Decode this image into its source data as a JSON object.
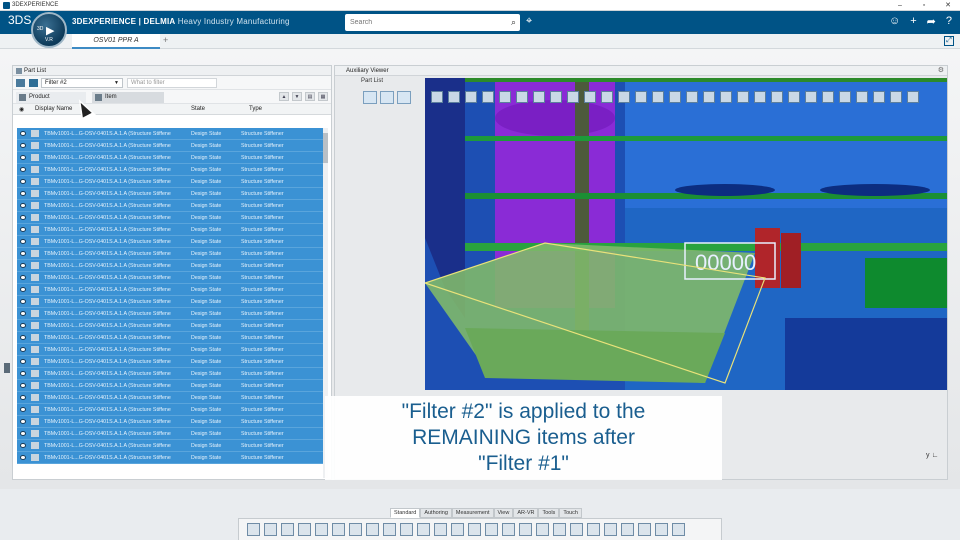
{
  "window": {
    "title": "3DEXPERIENCE",
    "controls": [
      "–",
      "▫",
      "✕"
    ]
  },
  "header": {
    "brand_mark": "3DS",
    "app_title_bold": "3DEXPERIENCE | DELMIA",
    "app_title_light": "Heavy Industry Manufacturing",
    "search_placeholder": "Search",
    "compass_label": "V.R",
    "compass_num": "3D"
  },
  "tabs": [
    {
      "label": "OSV01 PPR A"
    }
  ],
  "part_list": {
    "header": "Part List",
    "filter_value": "Filter #2",
    "filter_hint": "What to filter",
    "tabs": [
      {
        "label": "Product"
      },
      {
        "label": "Item"
      }
    ],
    "columns": {
      "name": "Display Name",
      "state": "State",
      "type": "Type"
    },
    "rows": [
      {
        "name": "TBMv1001-L...G-OSV-0401S.A.1.A (Structure Stiffene",
        "state": "Design State",
        "type": "Structure Stiffener"
      },
      {
        "name": "TBMv1001-L...G-OSV-0401S.A.1.A (Structure Stiffene",
        "state": "Design State",
        "type": "Structure Stiffener"
      },
      {
        "name": "TBMv1001-L...G-OSV-0401S.A.1.A (Structure Stiffene",
        "state": "Design State",
        "type": "Structure Stiffener"
      },
      {
        "name": "TBMv1001-L...G-OSV-0401S.A.1.A (Structure Stiffene",
        "state": "Design State",
        "type": "Structure Stiffener"
      },
      {
        "name": "TBMv1001-L...G-OSV-0401S.A.1.A (Structure Stiffene",
        "state": "Design State",
        "type": "Structure Stiffener"
      },
      {
        "name": "TBMv1001-L...G-OSV-0401S.A.1.A (Structure Stiffene",
        "state": "Design State",
        "type": "Structure Stiffener"
      },
      {
        "name": "TBMv1001-L...G-OSV-0401S.A.1.A (Structure Stiffene",
        "state": "Design State",
        "type": "Structure Stiffener"
      },
      {
        "name": "TBMv1001-L...G-OSV-0401S.A.1.A (Structure Stiffene",
        "state": "Design State",
        "type": "Structure Stiffener"
      },
      {
        "name": "TBMv1001-L...G-OSV-0401S.A.1.A (Structure Stiffene",
        "state": "Design State",
        "type": "Structure Stiffener"
      },
      {
        "name": "TBMv1001-L...G-OSV-0401S.A.1.A (Structure Stiffene",
        "state": "Design State",
        "type": "Structure Stiffener"
      },
      {
        "name": "TBMv1001-L...G-OSV-0401S.A.1.A (Structure Stiffene",
        "state": "Design State",
        "type": "Structure Stiffener"
      },
      {
        "name": "TBMv1001-L...G-OSV-0401S.A.1.A (Structure Stiffene",
        "state": "Design State",
        "type": "Structure Stiffener"
      },
      {
        "name": "TBMv1001-L...G-OSV-0401S.A.1.A (Structure Stiffene",
        "state": "Design State",
        "type": "Structure Stiffener"
      },
      {
        "name": "TBMv1001-L...G-OSV-0401S.A.1.A (Structure Stiffene",
        "state": "Design State",
        "type": "Structure Stiffener"
      },
      {
        "name": "TBMv1001-L...G-OSV-0401S.A.1.A (Structure Stiffene",
        "state": "Design State",
        "type": "Structure Stiffener"
      },
      {
        "name": "TBMv1001-L...G-OSV-0401S.A.1.A (Structure Stiffene",
        "state": "Design State",
        "type": "Structure Stiffener"
      },
      {
        "name": "TBMv1001-L...G-OSV-0401S.A.1.A (Structure Stiffene",
        "state": "Design State",
        "type": "Structure Stiffener"
      },
      {
        "name": "TBMv1001-L...G-OSV-0401S.A.1.A (Structure Stiffene",
        "state": "Design State",
        "type": "Structure Stiffener"
      },
      {
        "name": "TBMv1001-L...G-OSV-0401S.A.1.A (Structure Stiffene",
        "state": "Design State",
        "type": "Structure Stiffener"
      },
      {
        "name": "TBMv1001-L...G-OSV-0401S.A.1.A (Structure Stiffene",
        "state": "Design State",
        "type": "Structure Stiffener"
      },
      {
        "name": "TBMv1001-L...G-OSV-0401S.A.1.A (Structure Stiffene",
        "state": "Design State",
        "type": "Structure Stiffener"
      },
      {
        "name": "TBMv1001-L...G-OSV-0401S.A.1.A (Structure Stiffene",
        "state": "Design State",
        "type": "Structure Stiffener"
      },
      {
        "name": "TBMv1001-L...G-OSV-0401S.A.1.A (Structure Stiffene",
        "state": "Design State",
        "type": "Structure Stiffener"
      },
      {
        "name": "TBMv1001-L...G-OSV-0401S.A.1.A (Structure Stiffene",
        "state": "Design State",
        "type": "Structure Stiffener"
      },
      {
        "name": "TBMv1001-L...G-OSV-0401S.A.1.A (Structure Stiffene",
        "state": "Design State",
        "type": "Structure Stiffener"
      },
      {
        "name": "TBMv1001-L...G-OSV-0401S.A.1.A (Structure Stiffene",
        "state": "Design State",
        "type": "Structure Stiffener"
      },
      {
        "name": "TBMv1001-L...G-OSV-0401S.A.1.A (Structure Stiffene",
        "state": "Design State",
        "type": "Structure Stiffener"
      },
      {
        "name": "TBMv1001-L...G-OSV-0401S.A.1.A (Structure Stiffene",
        "state": "Design State",
        "type": "Structure Stiffener"
      }
    ]
  },
  "aux_viewer": {
    "header": "Auxiliary Viewer",
    "subheader": "Part List",
    "counter": "00000"
  },
  "caption": {
    "line1": "\"Filter #2\" is applied to the",
    "line2": "REMAINING items after",
    "line3": "\"Filter #1\""
  },
  "axis_label": "y",
  "bottom_tabs": [
    "Standard",
    "Authoring",
    "Measurement",
    "View",
    "AR-VR",
    "Tools",
    "Touch"
  ],
  "colors": {
    "header": "#005386",
    "row_selected": "#3b92d4",
    "caption_text": "#1a5e8f"
  }
}
